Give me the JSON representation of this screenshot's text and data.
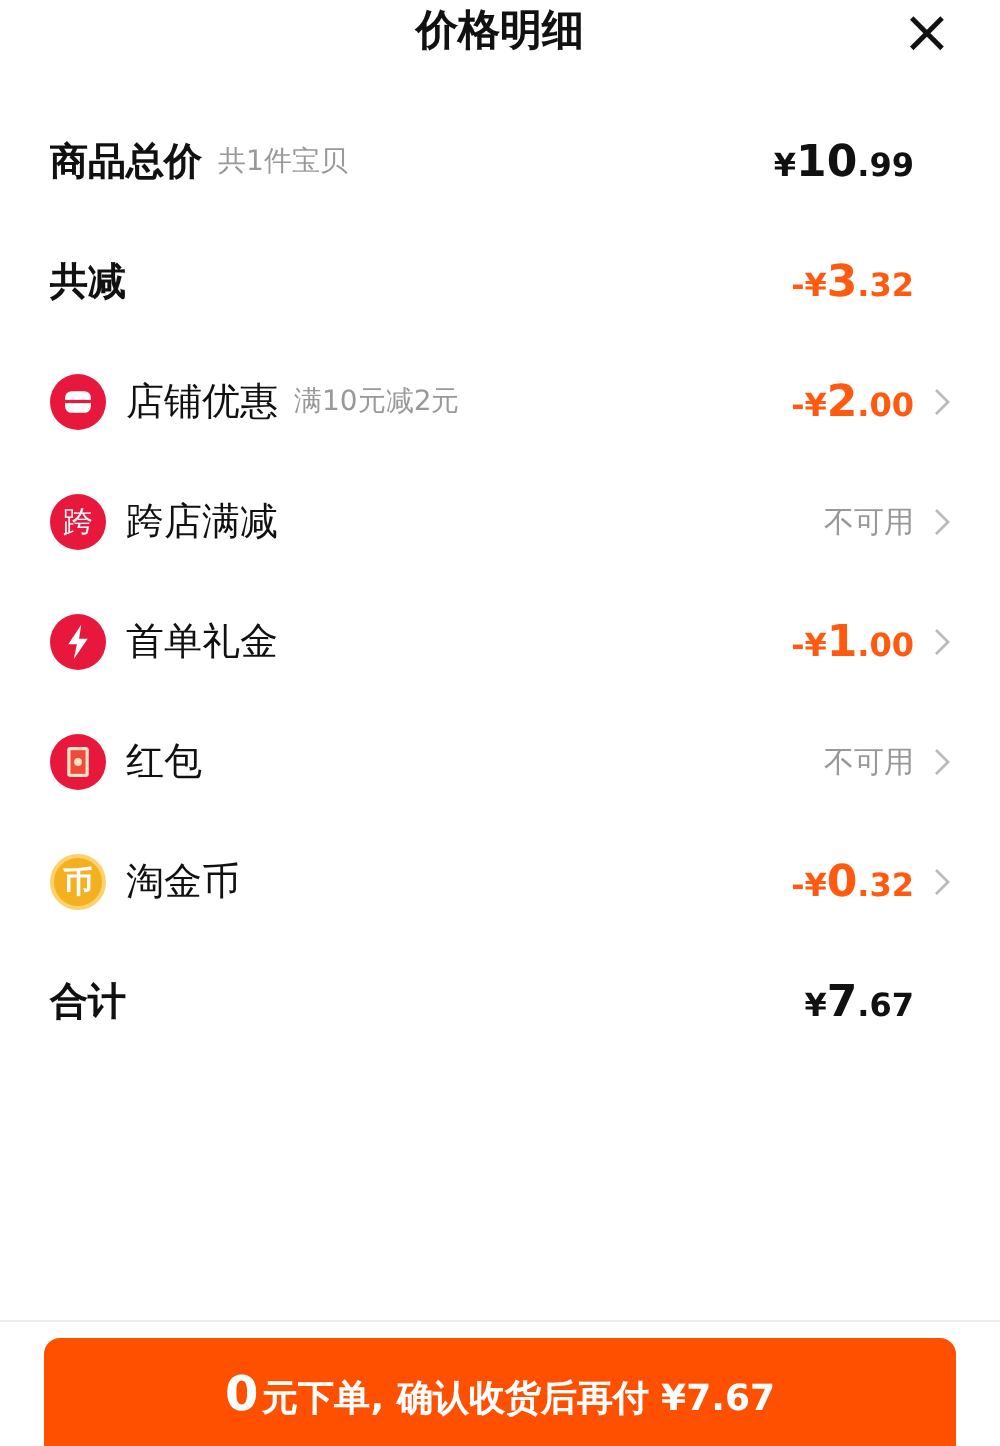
{
  "header": {
    "title": "价格明细",
    "close": "×"
  },
  "rows": [
    {
      "kind": "summary",
      "label": "商品总价",
      "note": "共1件宝贝",
      "value": "¥10.99",
      "color": "#111111",
      "chevron": false
    },
    {
      "kind": "summary",
      "label": "共减",
      "value": "-¥3.32",
      "color": "#ff5a0f",
      "chevron": false
    },
    {
      "kind": "shop",
      "label": "店铺优惠",
      "note": "满10元减2元",
      "value": "-¥2.00",
      "color": "#ff5a0f",
      "chevron": true
    },
    {
      "kind": "badge",
      "icon_text": "跨",
      "label": "跨店满减",
      "value": "不可用",
      "color": "#999999",
      "chevron": true
    },
    {
      "kind": "bolt",
      "label": "首单礼金",
      "value": "-¥1.00",
      "color": "#ff5a0f",
      "chevron": true
    },
    {
      "kind": "packet",
      "label": "红包",
      "value": "不可用",
      "color": "#999999",
      "chevron": true
    },
    {
      "kind": "coin",
      "icon_text": "币",
      "label": "淘金币",
      "value": "-¥0.32",
      "color": "#ff5a0f",
      "chevron": true
    },
    {
      "kind": "summary",
      "label": "合计",
      "value": "¥7.67",
      "color": "#111111",
      "chevron": false
    }
  ],
  "action": {
    "lead": "0",
    "text": "元下单, 确认收货后再付 ¥7.67"
  }
}
